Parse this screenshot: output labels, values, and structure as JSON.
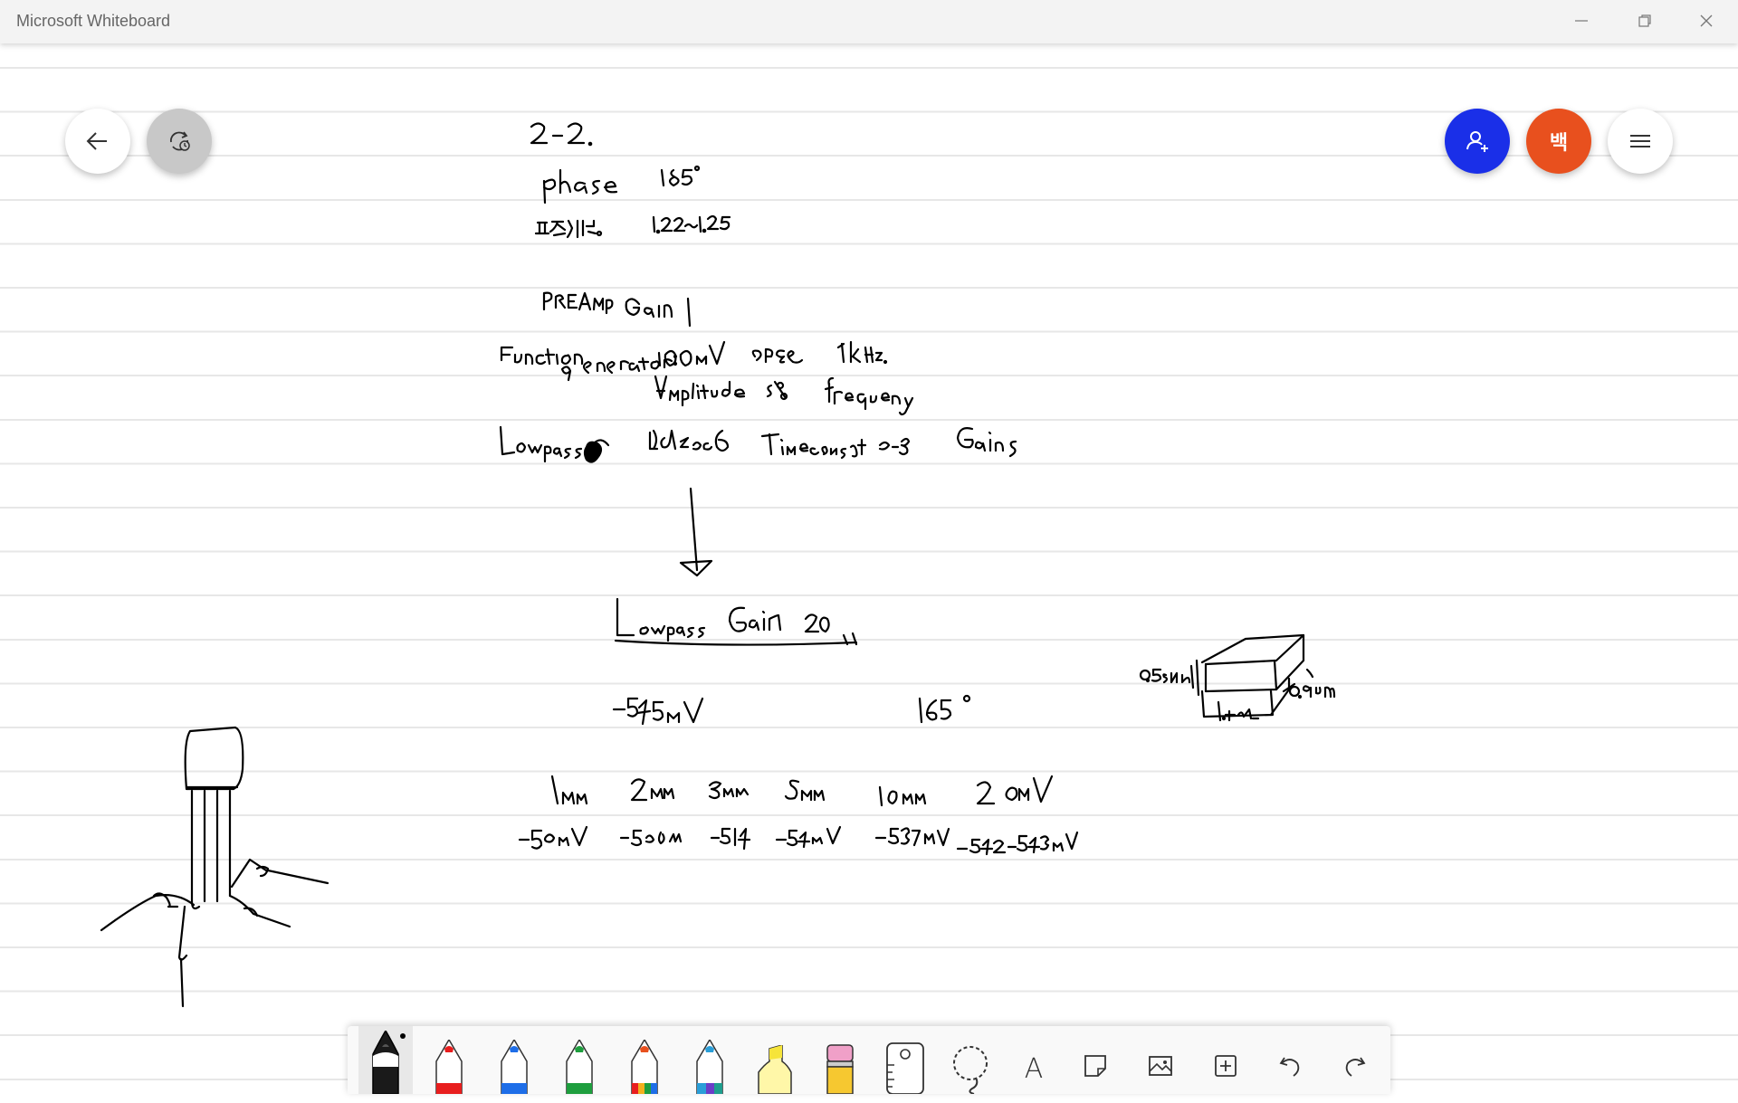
{
  "window": {
    "title": "Microsoft Whiteboard"
  },
  "header": {
    "user_initial": "백"
  },
  "colors": {
    "invite_button": "#1a2fe8",
    "user_avatar": "#e8501e",
    "ink": "#000000"
  },
  "toolbar": {
    "tools": [
      "black-pen",
      "red-pen",
      "blue-pen",
      "green-pen",
      "rainbow-pen",
      "galaxy-pen",
      "yellow-highlighter",
      "eraser",
      "ruler",
      "lasso",
      "text",
      "sticky-note",
      "image",
      "insert",
      "undo",
      "redo"
    ],
    "text_tool_label": "A"
  }
}
